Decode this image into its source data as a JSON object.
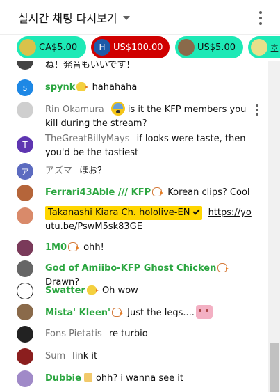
{
  "header": {
    "title": "실시간 채팅 다시보기"
  },
  "ticker": {
    "chips": [
      {
        "amount": "CA$5.00",
        "bg": "#1de9b6",
        "fg": "#0f0f0f",
        "avatar_bg": "#d9c24a"
      },
      {
        "amount": "US$100.00",
        "bg": "#d00000",
        "fg": "#ffffff",
        "avatar_bg": "#1e5aa8",
        "avatar_letter": "H"
      },
      {
        "amount": "US$5.00",
        "bg": "#1de9b6",
        "fg": "#0f0f0f",
        "avatar_bg": "#8a6a4a"
      },
      {
        "amount": "호",
        "bg": "#1de9b6",
        "fg": "#0f0f0f",
        "avatar_bg": "#e6e08a"
      }
    ]
  },
  "messages": [
    {
      "author": "",
      "text": "ね！発音もいいです！"
    },
    {
      "author": "spynk",
      "text": "hahahaha",
      "avatar_letter": "s",
      "avatar_bg": "#1e88e5"
    },
    {
      "author": "Rin Okamura",
      "text": "is it the KFP members you kill during the stream?"
    },
    {
      "author": "TheGreatBillyMays",
      "text": "if looks were taste, then you'd be the tastiest",
      "avatar_letter": "T",
      "avatar_bg": "#5e35b1"
    },
    {
      "author": "アズマ",
      "text": "ほお？",
      "avatar_letter": "ア",
      "avatar_bg": "#5c6bc0"
    },
    {
      "author": "Ferrari43Able /// KFP",
      "text": "Korean clips? Cool"
    },
    {
      "author": "Takanashi Kiara Ch. hololive-EN",
      "link": "https://youtu.be/PswM5sk83GE"
    },
    {
      "author": "1M0",
      "text": "ohh!"
    },
    {
      "author": "God of Amiibo-KFP Ghost Chicken",
      "text": "Drawn?"
    },
    {
      "author": "Swatter",
      "text": "Oh wow"
    },
    {
      "author": "Mista' Kleen'",
      "text": "Just the legs...."
    },
    {
      "author": "Fons Pietatis",
      "text": "re turbio"
    },
    {
      "author": "Sum",
      "text": "link it"
    },
    {
      "author": "Dubbie",
      "text": "ohh? i wanna see it"
    }
  ]
}
